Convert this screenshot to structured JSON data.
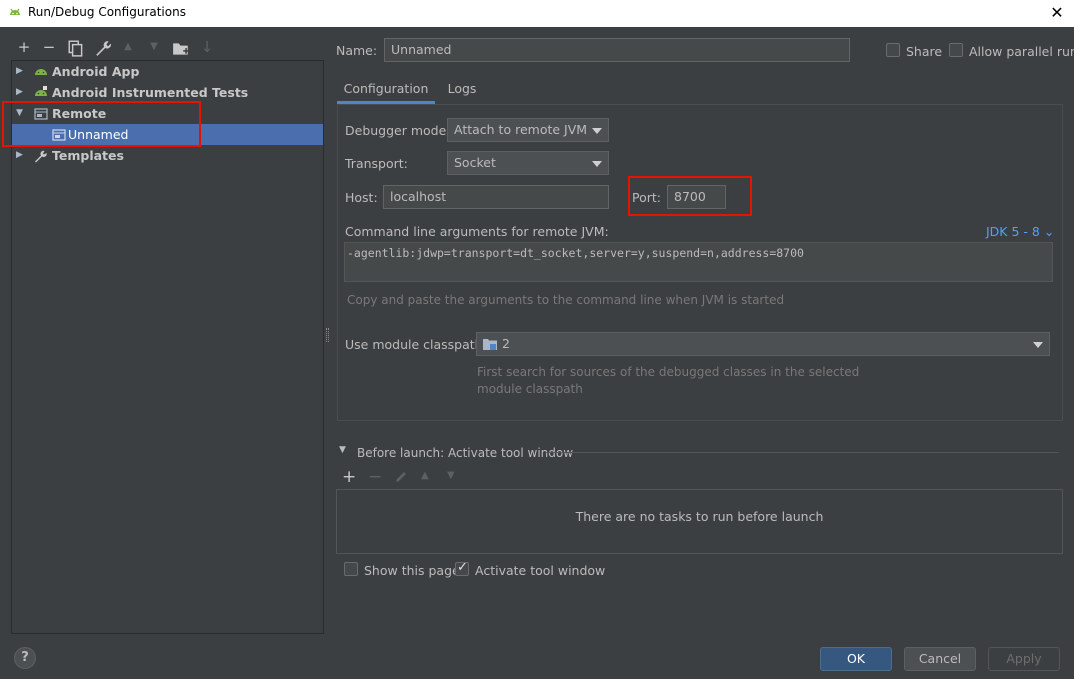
{
  "window": {
    "title": "Run/Debug Configurations",
    "close_glyph": "✕"
  },
  "toolbar": {
    "icons": [
      "add-icon",
      "remove-icon",
      "copy-icon",
      "wrench-icon",
      "move-up-icon",
      "move-down-icon",
      "new-folder-icon",
      "sort-icon"
    ],
    "add": "+",
    "remove": "−",
    "up": "▲",
    "down": "▼",
    "sort": "↓"
  },
  "tree": {
    "items": [
      {
        "label": "Android App",
        "expanded": false
      },
      {
        "label": "Android Instrumented Tests",
        "expanded": false
      },
      {
        "label": "Remote",
        "expanded": true
      },
      {
        "label": "Unnamed",
        "selected": true
      },
      {
        "label": "Templates",
        "expanded": false
      }
    ],
    "arrow_collapsed": "▶",
    "arrow_expanded": "▼"
  },
  "header": {
    "name_label": "Name:",
    "name_value": "Unnamed",
    "share_label": "Share",
    "share_checked": false,
    "parallel_label": "Allow parallel run",
    "parallel_checked": false
  },
  "tabs": [
    {
      "label": "Configuration",
      "active": true
    },
    {
      "label": "Logs",
      "active": false
    }
  ],
  "config": {
    "debugger_mode_label": "Debugger mode:",
    "debugger_mode_value": "Attach to remote JVM",
    "transport_label": "Transport:",
    "transport_value": "Socket",
    "host_label": "Host:",
    "host_value": "localhost",
    "port_label": "Port:",
    "port_value": "8700",
    "cmd_label": "Command line arguments for remote JVM:",
    "jdk_link": "JDK 5 - 8",
    "jdk_chevron": "⌄",
    "cmd_value": "-agentlib:jdwp=transport=dt_socket,server=y,suspend=n,address=8700",
    "cmd_hint": "Copy and paste the arguments to the command line when JVM is started",
    "module_label": "Use module classpath:",
    "module_value": "2",
    "module_hint_line1": "First search for sources of the debugged classes in the selected",
    "module_hint_line2": "module classpath"
  },
  "before_launch": {
    "title": "Before launch: Activate tool window",
    "empty_text": "There are no tasks to run before launch",
    "add": "+",
    "remove": "−",
    "up": "▲",
    "down": "▼"
  },
  "footer": {
    "show_page_label": "Show this page",
    "show_page_checked": false,
    "activate_label": "Activate tool window",
    "activate_checked": true,
    "help": "?",
    "ok": "OK",
    "cancel": "Cancel",
    "apply": "Apply"
  },
  "colors": {
    "background": "#3c3f41",
    "selection": "#4b6eaf",
    "accent_link": "#589df6",
    "highlight_box": "#e51400",
    "primary_button": "#365880"
  }
}
